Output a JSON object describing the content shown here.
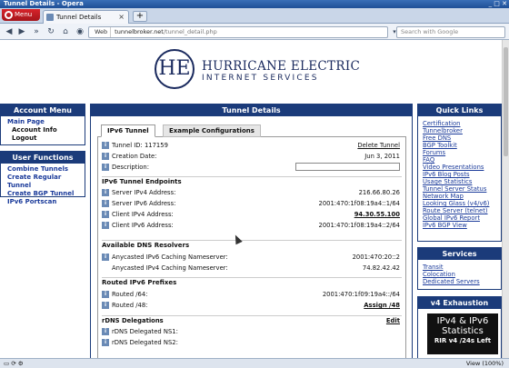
{
  "window": {
    "title": "Tunnel Details - Opera",
    "controls": "_ □ ✕"
  },
  "browser": {
    "menu_label": "Menu",
    "tab_title": "Tunnel Details",
    "address_web": "Web",
    "address_domain": "tunnelbroker.net",
    "address_path": "/tunnel_detail.php",
    "search_placeholder": "Search with Google",
    "zoom": "View (100%)"
  },
  "logo": {
    "monogram": "HE",
    "line1": "HURRICANE ELECTRIC",
    "line2": "INTERNET SERVICES"
  },
  "account_menu": {
    "title": "Account Menu",
    "items": [
      {
        "label": "Main Page",
        "sub": false
      },
      {
        "label": "Account Info",
        "sub": true
      },
      {
        "label": "Logout",
        "sub": true
      }
    ]
  },
  "user_functions": {
    "title": "User Functions",
    "items": [
      "Combine Tunnels",
      "Create Regular Tunnel",
      "Create BGP Tunnel",
      "IPv6 Portscan"
    ]
  },
  "main": {
    "title": "Tunnel Details",
    "tabs": [
      "IPv6 Tunnel",
      "Example Configurations"
    ],
    "tunnel_id_label": "Tunnel ID: 117159",
    "delete_link": "Delete Tunnel",
    "creation_date_label": "Creation Date:",
    "creation_date": "Jun 3, 2011",
    "description_label": "Description:",
    "endpoints_title": "IPv6 Tunnel Endpoints",
    "endpoints": [
      {
        "label": "Server IPv4 Address:",
        "value": "216.66.80.26"
      },
      {
        "label": "Server IPv6 Address:",
        "value": "2001:470:1f08:19a4::1/64"
      },
      {
        "label": "Client IPv4 Address:",
        "value": "94.30.55.100"
      },
      {
        "label": "Client IPv6 Address:",
        "value": "2001:470:1f08:19a4::2/64"
      }
    ],
    "dns_title": "Available DNS Resolvers",
    "dns": [
      {
        "label": "Anycasted IPv6 Caching Nameserver:",
        "value": "2001:470:20::2"
      },
      {
        "label": "Anycasted IPv4 Caching Nameserver:",
        "value": "74.82.42.42"
      }
    ],
    "prefixes_title": "Routed IPv6 Prefixes",
    "prefixes": [
      {
        "label": "Routed /64:",
        "value": "2001:470:1f09:19a4::/64"
      },
      {
        "label": "Routed /48:",
        "value": "Assign /48"
      }
    ],
    "rdns_title": "rDNS Delegations",
    "rdns_edit": "Edit",
    "rdns": [
      "rDNS Delegated NS1:",
      "rDNS Delegated NS2:"
    ]
  },
  "quick_links": {
    "title": "Quick Links",
    "items": [
      "Certification",
      "Tunnelbroker",
      "Free DNS",
      "BGP Toolkit",
      "Forums",
      "FAQ",
      "Video Presentations",
      "IPv6 Blog Posts",
      "Usage Statistics",
      "Tunnel Server Status",
      "Network Map",
      "Looking Glass (v4/v6)",
      "Route Server (telnet)",
      "Global IPv6 Report",
      "IPv6 BGP View"
    ]
  },
  "services": {
    "title": "Services",
    "items": [
      "Transit",
      "Colocation",
      "Dedicated Servers"
    ]
  },
  "exhaustion": {
    "title": "v4 Exhaustion",
    "line1": "IPv4 & IPv6",
    "line2": "Statistics",
    "line3": "RIR v4 /24s Left"
  }
}
